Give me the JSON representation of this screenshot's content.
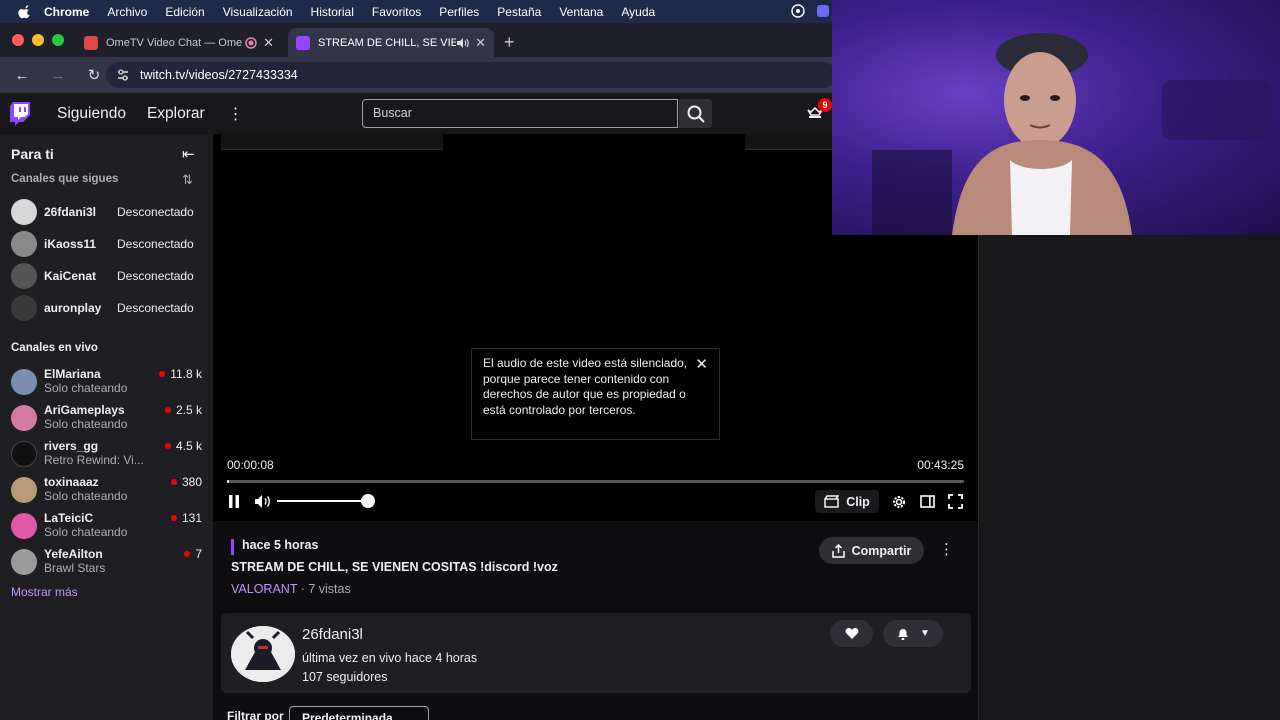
{
  "menubar": {
    "app": "Chrome",
    "items": [
      "Archivo",
      "Edición",
      "Visualización",
      "Historial",
      "Favoritos",
      "Perfiles",
      "Pestaña",
      "Ventana",
      "Ayuda"
    ]
  },
  "tabs": [
    {
      "title": "OmeTV Video Chat — Ome"
    },
    {
      "title": "STREAM DE CHILL, SE VIE"
    }
  ],
  "address": {
    "url": "twitch.tv/videos/2727433334"
  },
  "topnav": {
    "following": "Siguiendo",
    "explore": "Explorar",
    "search_placeholder": "Buscar",
    "notifications_count": "9"
  },
  "sidebar": {
    "title": "Para ti",
    "followed_header": "Canales que sigues",
    "followed": [
      {
        "name": "26fdani3l",
        "status": "Desconectado"
      },
      {
        "name": "iKaoss11",
        "status": "Desconectado"
      },
      {
        "name": "KaiCenat",
        "status": "Desconectado"
      },
      {
        "name": "auronplay",
        "status": "Desconectado"
      }
    ],
    "live_header": "Canales en vivo",
    "live": [
      {
        "name": "ElMariana",
        "category": "Solo chateando",
        "viewers": "11.8 k"
      },
      {
        "name": "AriGameplays",
        "category": "Solo chateando",
        "viewers": "2.5 k"
      },
      {
        "name": "rivers_gg",
        "category": "Retro Rewind: Vi...",
        "viewers": "4.5 k"
      },
      {
        "name": "toxinaaaz",
        "category": "Solo chateando",
        "viewers": "380"
      },
      {
        "name": "LaTeiciC",
        "category": "Solo chateando",
        "viewers": "131"
      },
      {
        "name": "YefeAilton",
        "category": "Brawl Stars",
        "viewers": "7"
      }
    ],
    "show_more": "Mostrar más"
  },
  "player": {
    "notice": "El audio de este video está silenciado, porque parece tener contenido con derechos de autor que es propiedad o está controlado por terceros.",
    "current_time": "00:00:08",
    "duration": "00:43:25",
    "progress": 0.003,
    "volume": 1.0,
    "clip_label": "Clip"
  },
  "video": {
    "ago": "hace 5 horas",
    "title": "STREAM DE CHILL, SE VIENEN COSITAS !discord !voz",
    "game": "VALORANT",
    "views": " · 7 vistas",
    "share_label": "Compartir"
  },
  "channel": {
    "name": "26fdani3l",
    "last_live": "última vez en vivo hace 4 horas",
    "followers": "107 seguidores"
  },
  "filter": {
    "label": "Filtrar por",
    "value": "Predeterminada"
  }
}
